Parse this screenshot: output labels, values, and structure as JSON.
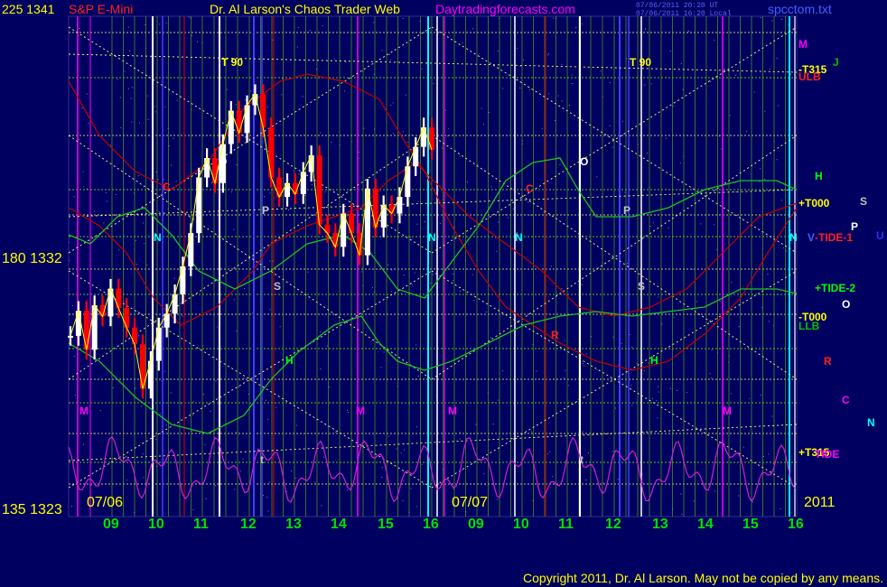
{
  "header": {
    "left_value": "225  1341",
    "symbol": "S&P E-Mini",
    "title": "Dr. Al Larson's Chaos Trader Web",
    "site": "Daytradingforecasts.com",
    "timestamp1": "07/06/2011 20:20 UT",
    "timestamp2": "07/06/2011 16:20 Local",
    "filename": "spcctom.txt"
  },
  "y_labels": [
    "225  1341",
    "180  1332",
    "135  1323"
  ],
  "date_labels": [
    "07/06",
    "07/07",
    "2011"
  ],
  "hour_labels": [
    "09",
    "10",
    "11",
    "12",
    "13",
    "14",
    "15",
    "16",
    "09",
    "10",
    "11",
    "12",
    "13",
    "14",
    "15",
    "16"
  ],
  "side_labels": [
    {
      "text": "M",
      "color": "#ff00ff"
    },
    {
      "text": "-T315",
      "color": "#ffff00"
    },
    {
      "text": "J",
      "color": "#00c000"
    },
    {
      "text": "ULB",
      "color": "#ff2020"
    },
    {
      "text": "H",
      "color": "#00ff00"
    },
    {
      "text": "+T000",
      "color": "#ffff00"
    },
    {
      "text": "S",
      "color": "#c0c0c0"
    },
    {
      "text": "P",
      "color": "#ffffff"
    },
    {
      "text": "V",
      "color": "#4060ff"
    },
    {
      "text": "-TIDE-1",
      "color": "#ff2020"
    },
    {
      "text": "U",
      "color": "#3030ff"
    },
    {
      "text": "+TIDE-2",
      "color": "#00ff00"
    },
    {
      "text": "O",
      "color": "#ffffff"
    },
    {
      "text": "-T000",
      "color": "#ffff00"
    },
    {
      "text": "LLB",
      "color": "#00c000"
    },
    {
      "text": "R",
      "color": "#ff2020"
    },
    {
      "text": "C",
      "color": "#ff00ff"
    },
    {
      "text": "N",
      "color": "#00ffff"
    },
    {
      "text": "+T315",
      "color": "#ffff00"
    },
    {
      "text": "TIDE",
      "color": "#ff00ff"
    }
  ],
  "cycle_labels": [
    {
      "text": "T  90",
      "color": "#ffff00"
    },
    {
      "text": "T  90",
      "color": "#ffff00"
    },
    {
      "text": "O",
      "color": "#ffffff"
    },
    {
      "text": "O",
      "color": "#ffffff"
    },
    {
      "text": "C",
      "color": "#ff2020"
    },
    {
      "text": "C",
      "color": "#ff2020"
    },
    {
      "text": "P",
      "color": "#c0c0c0"
    },
    {
      "text": "P",
      "color": "#c0c0c0"
    },
    {
      "text": "S",
      "color": "#c0c0c0"
    },
    {
      "text": "S",
      "color": "#c0c0c0"
    },
    {
      "text": "N",
      "color": "#00ffff"
    },
    {
      "text": "N",
      "color": "#00ffff"
    },
    {
      "text": "N",
      "color": "#00ffff"
    },
    {
      "text": "N",
      "color": "#00ffff"
    },
    {
      "text": "H",
      "color": "#00ff00"
    },
    {
      "text": "H",
      "color": "#00ff00"
    },
    {
      "text": "M",
      "color": "#ff00ff"
    },
    {
      "text": "M",
      "color": "#ff00ff"
    },
    {
      "text": "M",
      "color": "#ff00ff"
    },
    {
      "text": "M",
      "color": "#ff00ff"
    },
    {
      "text": "R",
      "color": "#ff2020"
    },
    {
      "text": "t",
      "color": "#c0c0c0"
    },
    {
      "text": "t",
      "color": "#c0c0c0"
    }
  ],
  "copyright": "Copyright 2011, Dr. Al Larson.  May not be copied by any means.",
  "colors": {
    "background": "#000060",
    "grid_green": "#80ff00",
    "grid_yellow": "#ffff80",
    "price_white": "#ffffff",
    "price_red": "#ff0000",
    "flux_red": "#c00000",
    "flux_green": "#20c020",
    "tide_magenta": "#d020d0"
  },
  "chart_data": {
    "type": "line",
    "title": "S&P E-Mini",
    "xlabel": "",
    "ylabel": "",
    "ylim": [
      1323,
      1341
    ],
    "ylim_alt": [
      135,
      225
    ],
    "x_hours": [
      "09",
      "10",
      "11",
      "12",
      "13",
      "14",
      "15",
      "16",
      "09",
      "10",
      "11",
      "12",
      "13",
      "14",
      "15",
      "16"
    ],
    "series": [
      {
        "name": "S&P E-Mini",
        "values": [
          1329.5,
          1330.4,
          1329.0,
          1330.6,
          1330.2,
          1331.2,
          1330.5,
          1329.8,
          1329.2,
          1327.6,
          1328.6,
          1329.8,
          1330.3,
          1331.0,
          1332.0,
          1333.2,
          1335.2,
          1335.9,
          1335.0,
          1336.4,
          1337.6,
          1336.8,
          1337.8,
          1338.2,
          1337.0,
          1335.2,
          1334.5,
          1335.0,
          1334.6,
          1335.4,
          1336.0,
          1333.5,
          1333.2,
          1332.7,
          1333.9,
          1333.2,
          1332.4,
          1334.8,
          1333.4,
          1334.2,
          1333.9,
          1334.5,
          1335.6,
          1336.3,
          1337.0,
          1336.2
        ]
      }
    ]
  }
}
